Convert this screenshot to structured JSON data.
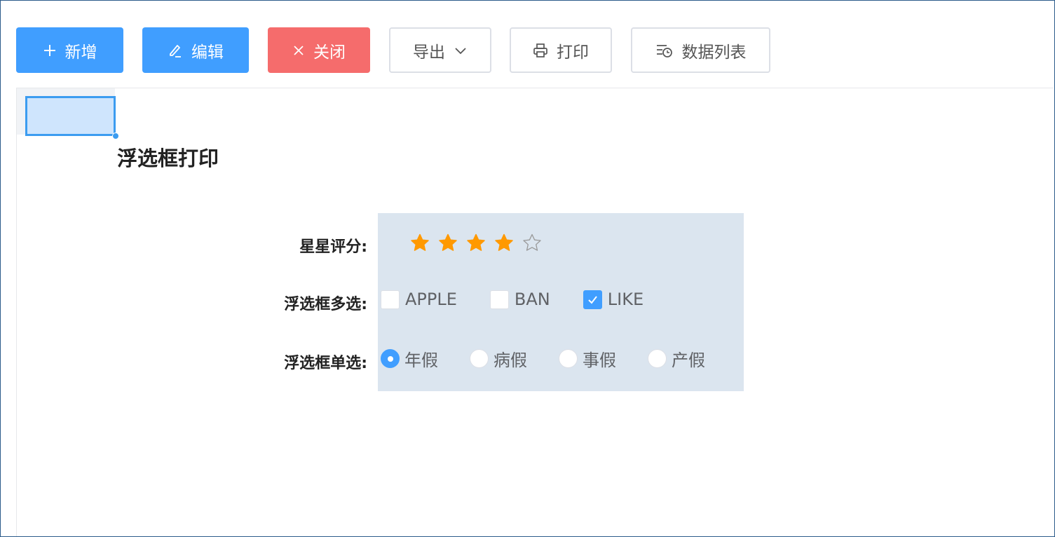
{
  "toolbar": {
    "add": "新增",
    "edit": "编辑",
    "close": "关闭",
    "export": "导出",
    "print": "打印",
    "data_list": "数据列表"
  },
  "sheet": {
    "title": "浮选框打印"
  },
  "form": {
    "rating_label": "星星评分:",
    "rating_value": 4,
    "rating_max": 5,
    "checkbox_label": "浮选框多选:",
    "checkbox_options": [
      {
        "label": "APPLE",
        "checked": false
      },
      {
        "label": "BAN",
        "checked": false
      },
      {
        "label": "LIKE",
        "checked": true
      }
    ],
    "radio_label": "浮选框单选:",
    "radio_options": [
      {
        "label": "年假",
        "selected": true
      },
      {
        "label": "病假",
        "selected": false
      },
      {
        "label": "事假",
        "selected": false
      },
      {
        "label": "产假",
        "selected": false
      }
    ]
  },
  "colors": {
    "primary": "#409eff",
    "danger": "#f56c6c",
    "star": "#ff9900",
    "form_bg": "#dbe5ef"
  }
}
